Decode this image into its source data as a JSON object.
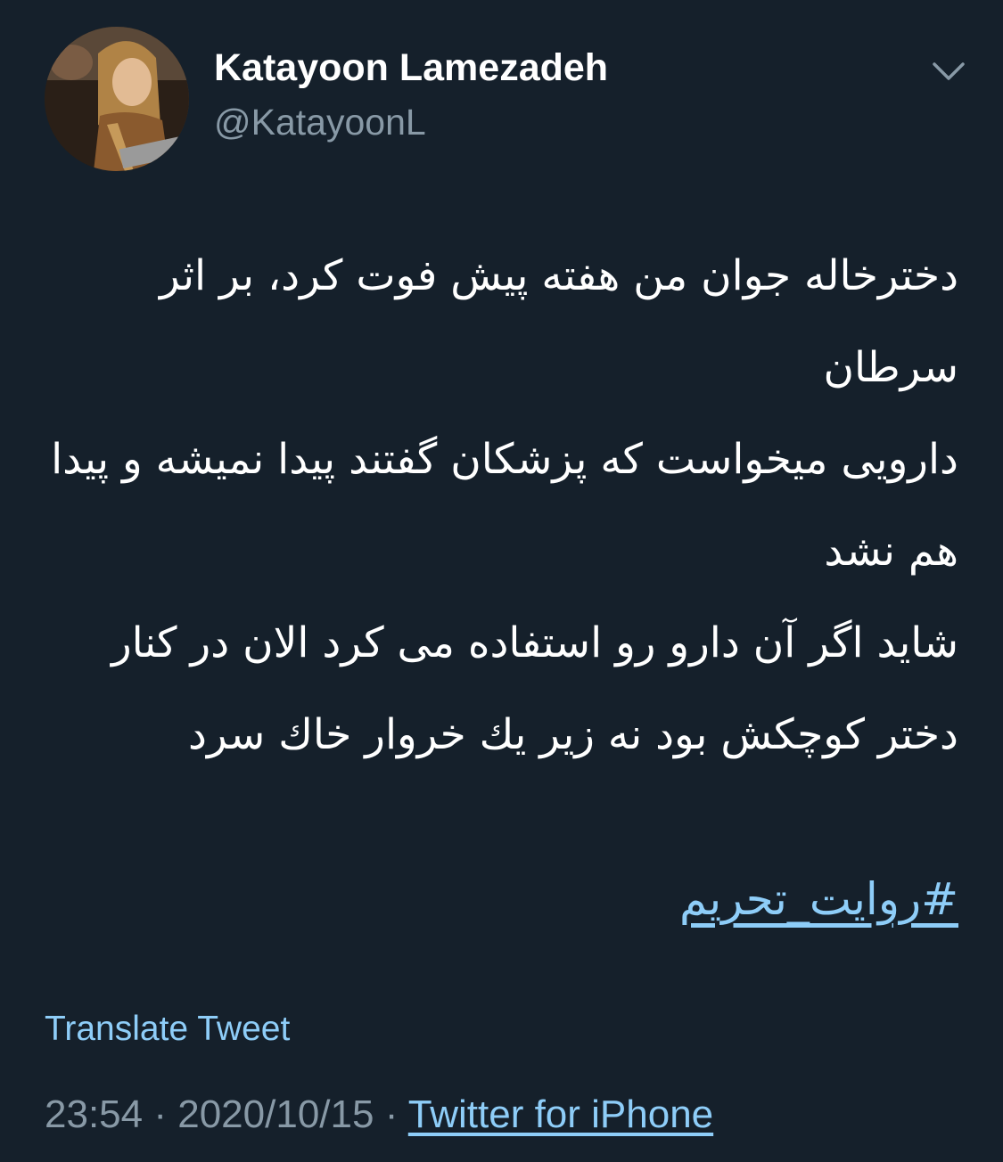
{
  "author": {
    "display_name": "Katayoon Lamezadeh",
    "handle": "@KatayoonL",
    "avatar_icon": "profile-photo"
  },
  "tweet": {
    "paragraph_1": "دخترخاله جوان من هفته پیش فوت کرد، بر اثر سرطان\nدارویی میخواست که پزشکان گفتند پیدا نمیشه و پیدا هم نشد",
    "paragraph_2": "شاید اگر آن دارو رو استفاده می کرد الان در کنار دختر کوچکش بود نه زیر یك خروار خاك سرد",
    "hashtag": "#روایت_تحریم",
    "translate_label": "Translate Tweet"
  },
  "meta": {
    "time": "23:54",
    "separator": "·",
    "date": "2020/10/15",
    "source": "Twitter for iPhone"
  },
  "colors": {
    "background": "#15202b",
    "link": "#8ecdf8",
    "secondary_text": "#8899a6"
  },
  "icons": {
    "menu": "chevron-down-icon"
  }
}
